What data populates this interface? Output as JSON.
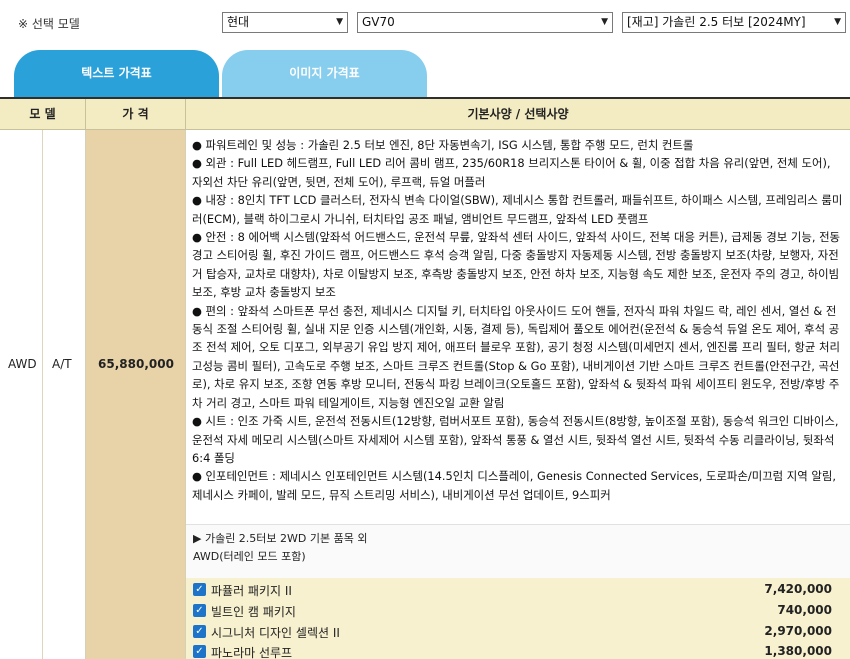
{
  "selector": {
    "label": "※ 선택 모델",
    "maker": "현대",
    "model": "GV70",
    "trim": "[재고] 가솔린 2.5 터보 [2024MY]"
  },
  "tabs": [
    {
      "label": "텍스트 가격표",
      "active": true
    },
    {
      "label": "이미지 가격표",
      "active": false
    }
  ],
  "table": {
    "headers": {
      "model": "모 델",
      "price": "가 격",
      "spec": "기본사양 / 선택사양"
    },
    "row": {
      "drive": "AWD",
      "transmission": "A/T",
      "price": "65,880,000",
      "specs": [
        "● 파워트레인 및 성능 : 가솔린 2.5 터보 엔진, 8단 자동변속기, ISG 시스템, 통합 주행 모드, 런치 컨트롤",
        "● 외관 : Full LED 헤드램프, Full LED 리어 콤비 램프, 235/60R18 브리지스톤 타이어 & 휠, 이중 접합 차음 유리(앞면, 전체 도어), 자외선 차단 유리(앞면, 뒷면, 전체 도어), 루프랙, 듀얼 머플러",
        "● 내장 : 8인치 TFT LCD 클러스터, 전자식 변속 다이얼(SBW), 제네시스 통합 컨트롤러, 패들쉬프트, 하이패스 시스템, 프레임리스 룸미러(ECM), 블랙 하이그로시 가니쉬, 터치타입 공조 패널, 앰비언트 무드램프, 앞좌석 LED 풋램프",
        "● 안전 : 8 에어백 시스템(앞좌석 어드밴스드, 운전석 무릎, 앞좌석 센터 사이드, 앞좌석 사이드, 전복 대응 커튼), 급제동 경보 기능, 전동경고 스티어링 휠, 후진 가이드 램프, 어드밴스드 후석 승객 알림, 다중 충돌방지 자동제동 시스템, 전방 충돌방지 보조(차량, 보행자, 자전거 탑승자, 교차로 대향차), 차로 이탈방지 보조, 후측방 충돌방지 보조, 안전 하차 보조, 지능형 속도 제한 보조, 운전자 주의 경고, 하이빔 보조, 후방 교차 충돌방지 보조",
        "● 편의 : 앞좌석 스마트폰 무선 충전, 제네시스 디지털 키, 터치타입 아웃사이드 도어 핸들, 전자식 파워 차일드 락, 레인 센서, 열선 & 전동식 조절 스티어링 휠, 실내 지문 인증 시스템(개인화, 시동, 결제 등), 독립제어 풀오토 에어컨(운전석 & 동승석 듀얼 온도 제어, 후석 공조 전석 제어, 오토 디포그, 외부공기 유입 방지 제어, 애프터 블로우 포함), 공기 청정 시스템(미세먼지 센서, 엔진룸 프리 필터, 항균 처리 고성능 콤비 필터), 고속도로 주행 보조, 스마트 크루즈 컨트롤(Stop & Go 포함), 내비게이션 기반 스마트 크루즈 컨트롤(안전구간, 곡선로), 차로 유지 보조, 조향 연동 후방 모니터, 전동식 파킹 브레이크(오토홀드 포함), 앞좌석 & 뒷좌석 파워 세이프티 윈도우, 전방/후방 주차 거리 경고, 스마트 파워 테일게이트, 지능형 엔진오일 교환 알림",
        "● 시트 : 인조 가죽 시트, 운전석 전동시트(12방향, 럼버서포트 포함), 동승석 전동시트(8방향, 높이조절 포함), 동승석 워크인 디바이스, 운전석 자세 메모리 시스템(스마트 자세제어 시스템 포함), 앞좌석 통풍 & 열선 시트, 뒷좌석 열선 시트, 뒷좌석 수동 리클라이닝, 뒷좌석 6:4 폴딩",
        "● 인포테인먼트 : 제네시스 인포테인먼트 시스템(14.5인치 디스플레이, Genesis Connected Services, 도로파손/미끄럼 지역 알림, 제네시스 카페이, 발레 모드, 뮤직 스트리밍 서비스), 내비게이션 무선 업데이트, 9스피커"
      ],
      "note": [
        "▶ 가솔린 2.5터보 2WD 기본 품목 외",
        "AWD(터레인 모드 포함)"
      ],
      "options": [
        {
          "name": "파퓰러 패키지 II",
          "price": "7,420,000",
          "checked": true
        },
        {
          "name": "빌트인 캠 패키지",
          "price": "740,000",
          "checked": true
        },
        {
          "name": "시그니처 디자인 셀렉션 II",
          "price": "2,970,000",
          "checked": true
        },
        {
          "name": "파노라마 선루프",
          "price": "1,380,000",
          "checked": true
        }
      ]
    }
  }
}
